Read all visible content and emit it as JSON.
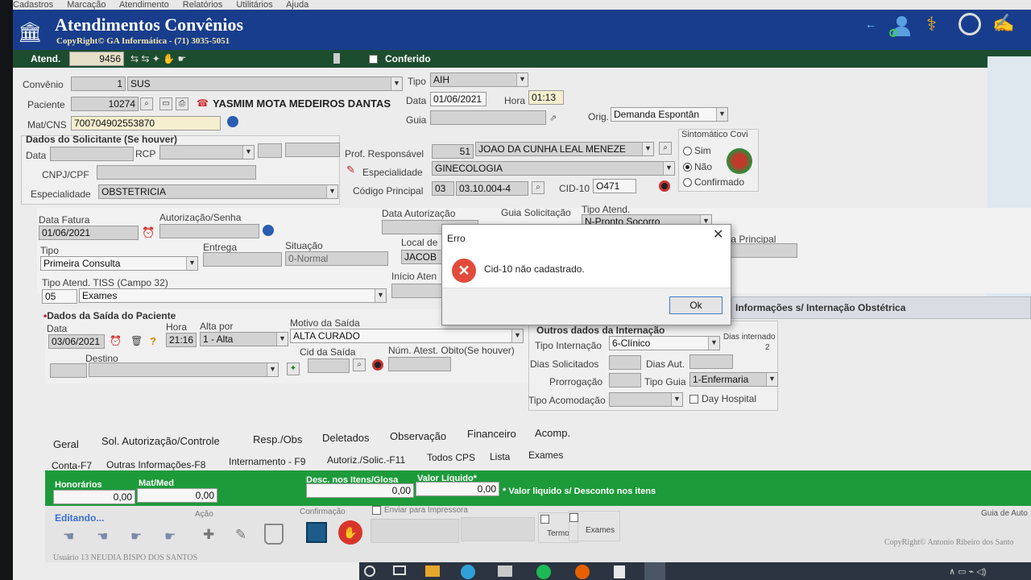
{
  "menu": [
    "Cadastros",
    "Marcação",
    "Atendimento",
    "Relatórios",
    "Utilitários",
    "Ajuda"
  ],
  "header": {
    "title": "Atendimentos Convênios",
    "subtitle": "CopyRight© GA Informática - (71) 3035-5051"
  },
  "toolbar": {
    "atend_label": "Atend.",
    "atend_value": "9456",
    "conferido_label": "Conferido"
  },
  "patient": {
    "convenio_label": "Convênio",
    "convenio_code": "1",
    "convenio_name": "SUS",
    "tipo_label": "Tipo",
    "tipo_value": "AIH",
    "paciente_label": "Paciente",
    "paciente_code": "10274",
    "paciente_name": "YASMIM MOTA MEDEIROS DANTAS",
    "data_label": "Data",
    "data_value": "01/06/2021",
    "hora_label": "Hora",
    "hora_value": "01:13",
    "matcns_label": "Mat/CNS",
    "matcns_value": "700704902553870",
    "guia_label": "Guia",
    "orig_label": "Orig.",
    "orig_value": "Demanda Espontân"
  },
  "solicitante": {
    "section_label": "Dados do Solicitante (Se houver)",
    "data_label": "Data",
    "rcp_label": "RCP",
    "cnpj_label": "CNPJ/CPF",
    "esp_label": "Especialidade",
    "esp_value": "OBSTETRICIA"
  },
  "profissional": {
    "prof_label": "Prof. Responsável",
    "prof_code": "51",
    "prof_name": "JOAO DA CUNHA LEAL MENEZE",
    "esp_label": "Especialidade",
    "esp_value": "GINECOLOGIA",
    "cod_label": "Código Principal",
    "cod_prefix": "03",
    "cod_value": "03.10.004-4",
    "cid_label": "CID-10",
    "cid_value": "O471"
  },
  "sintomatico": {
    "title": "Sintomático Covi",
    "options": [
      "Sim",
      "Não",
      "Confirmado"
    ],
    "selected": "Não"
  },
  "fatura": {
    "data_fatura_label": "Data Fatura",
    "data_fatura_value": "01/06/2021",
    "autorizacao_label": "Autorização/Senha",
    "data_aut_label": "Data Autorização",
    "guia_sol_label": "Guia Solicitação",
    "tipo_atend_label": "Tipo Atend.",
    "tipo_atend_value": "N-Pronto Socorro",
    "tipo_label": "Tipo",
    "tipo_value": "Primeira Consulta",
    "entrega_label": "Entrega",
    "situacao_label": "Situação",
    "situacao_value": "0-Normal",
    "local_label": "Local de",
    "local_value": "JACOB",
    "guia_principal_label": "uia Principal",
    "tiss_label": "Tipo Atend. TISS (Campo 32)",
    "tiss_code": "05",
    "tiss_value": "Exames",
    "inicio_label": "Início Aten"
  },
  "saida": {
    "section_label": "Dados da Saída do Paciente",
    "data_label": "Data",
    "data_value": "03/06/2021",
    "hora_label": "Hora",
    "hora_value": "21:16",
    "alta_label": "Alta por",
    "alta_value": "1 - Alta",
    "motivo_label": "Motivo da Saída",
    "motivo_value": "ALTA CURADO",
    "destino_label": "Destino",
    "cid_saida_label": "Cid da Saída",
    "obito_label": "Núm. Atest. Obito(Se houver)"
  },
  "obstetrica_tab": "Informações s/ Internação Obstétrica",
  "internacao": {
    "section_label": "Outros dados da Internação",
    "tipo_label": "Tipo Internação",
    "tipo_value": "6-Clínico",
    "dias_internado_label": "Dias internado",
    "dias_internado_value": "2",
    "dias_sol_label": "Dias Solicitados",
    "dias_aut_label": "Dias Aut.",
    "prorrogacao_label": "Prorrogação",
    "tipo_guia_label": "Tipo Guia",
    "tipo_guia_value": "1-Enfermaria",
    "acomodacao_label": "Tipo Acomodação",
    "day_hospital_label": "Day Hospital"
  },
  "tabs_row1": [
    "Geral",
    "Sol. Autorização/Controle",
    "Resp./Obs",
    "Deletados",
    "Observação",
    "Financeiro",
    "Acomp."
  ],
  "tabs_row2": [
    "Conta-F7",
    "Outras Informações-F8",
    "Internamento - F9",
    "Autoriz./Solic.-F11",
    "Todos CPS",
    "Lista",
    "Exames"
  ],
  "totals": {
    "honorarios_label": "Honorários",
    "honorarios_value": "0,00",
    "matmed_label": "Mat/Med",
    "matmed_value": "0,00",
    "desc_label": "Desc. nos Itens/Glosa",
    "desc_value": "0,00",
    "liquido_label": "Valor Líquido*",
    "liquido_value": "0,00",
    "note": "* Valor liquido s/ Desconto nos itens"
  },
  "bottom": {
    "editando": "Editando...",
    "acao": "Ação",
    "confirmacao": "Confirmação",
    "enviar": "Enviar para Impressora",
    "termo": "Termo",
    "exames": "Exames",
    "guia_auto": "Guia de Auto",
    "copyright": "CopyRight© Antonio Ribeiro dos Santo",
    "usuario": "Usuário 13 NEUDIA BISPO DOS SANTOS"
  },
  "dialog": {
    "title": "Erro",
    "message": "Cid-10 não cadastrado.",
    "ok_label": "Ok"
  },
  "colors": {
    "title_blue": "#183d8c",
    "toolbar_green": "#1d4d2f",
    "totals_green": "#1d9a3a",
    "error_red": "#e74c3c"
  }
}
